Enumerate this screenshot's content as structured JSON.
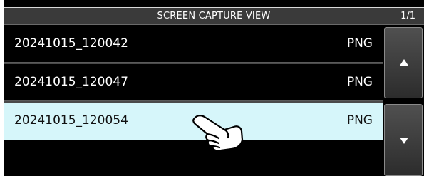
{
  "header": {
    "title": "SCREEN CAPTURE VIEW",
    "page_indicator": "1/1"
  },
  "files": [
    {
      "name": "20241015_120042",
      "type": "PNG",
      "selected": false
    },
    {
      "name": "20241015_120047",
      "type": "PNG",
      "selected": false
    },
    {
      "name": "20241015_120054",
      "type": "PNG",
      "selected": true
    }
  ],
  "scroll": {
    "up_icon": "triangle-up-icon",
    "down_icon": "triangle-down-icon"
  },
  "pointer": {
    "icon": "pointing-hand-icon"
  },
  "colors": {
    "background": "#000000",
    "title_bar": "#3a3a3a",
    "selected_row": "#d6f6fa",
    "text_light": "#ffffff",
    "text_dark": "#111111"
  }
}
